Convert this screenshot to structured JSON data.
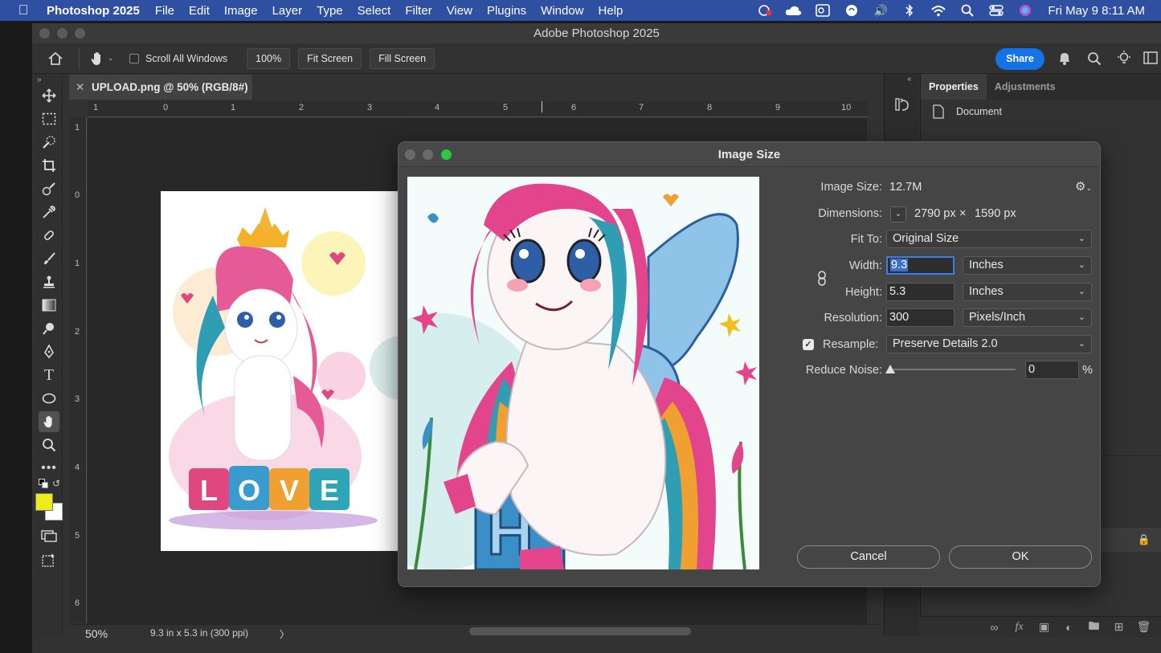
{
  "menubar": {
    "app_name": "Photoshop 2025",
    "items": [
      "File",
      "Edit",
      "Image",
      "Layer",
      "Type",
      "Select",
      "Filter",
      "View",
      "Plugins",
      "Window",
      "Help"
    ],
    "clock": "Fri May 9  8:11 AM"
  },
  "window": {
    "title": "Adobe Photoshop 2025"
  },
  "options_bar": {
    "scroll_all_label": "Scroll All Windows",
    "zoom_button": "100%",
    "fit_screen": "Fit Screen",
    "fill_screen": "Fill Screen",
    "share": "Share"
  },
  "document": {
    "tab_title": "UPLOAD.png @ 50% (RGB/8#)",
    "ruler_top": [
      "1",
      "0",
      "1",
      "2",
      "3",
      "4",
      "5",
      "6",
      "7",
      "8",
      "9",
      "10"
    ],
    "ruler_left": [
      "1",
      "0",
      "1",
      "2",
      "3",
      "4",
      "5",
      "6"
    ],
    "artboard_text": "LOVE"
  },
  "status": {
    "zoom": "50%",
    "info": "9.3 in x 5.3 in (300 ppi)"
  },
  "properties": {
    "tabs": [
      "Properties",
      "Adjustments"
    ],
    "doc_label": "Document"
  },
  "dialog": {
    "title": "Image Size",
    "image_size_label": "Image Size:",
    "image_size_value": "12.7M",
    "dimensions_label": "Dimensions:",
    "dim_width": "2790 px",
    "dim_times": "×",
    "dim_height": "1590 px",
    "fit_to_label": "Fit To:",
    "fit_to_value": "Original Size",
    "width_label": "Width:",
    "width_value": "9.3",
    "width_unit": "Inches",
    "height_label": "Height:",
    "height_value": "5.3",
    "height_unit": "Inches",
    "resolution_label": "Resolution:",
    "resolution_value": "300",
    "resolution_unit": "Pixels/Inch",
    "resample_label": "Resample:",
    "resample_value": "Preserve Details 2.0",
    "reduce_noise_label": "Reduce Noise:",
    "reduce_noise_value": "0",
    "percent": "%",
    "cancel": "Cancel",
    "ok": "OK",
    "preview_letter": "H"
  },
  "colors": {
    "foreground": "#ecec1a",
    "background": "#ffffff",
    "accent": "#1473e6"
  }
}
